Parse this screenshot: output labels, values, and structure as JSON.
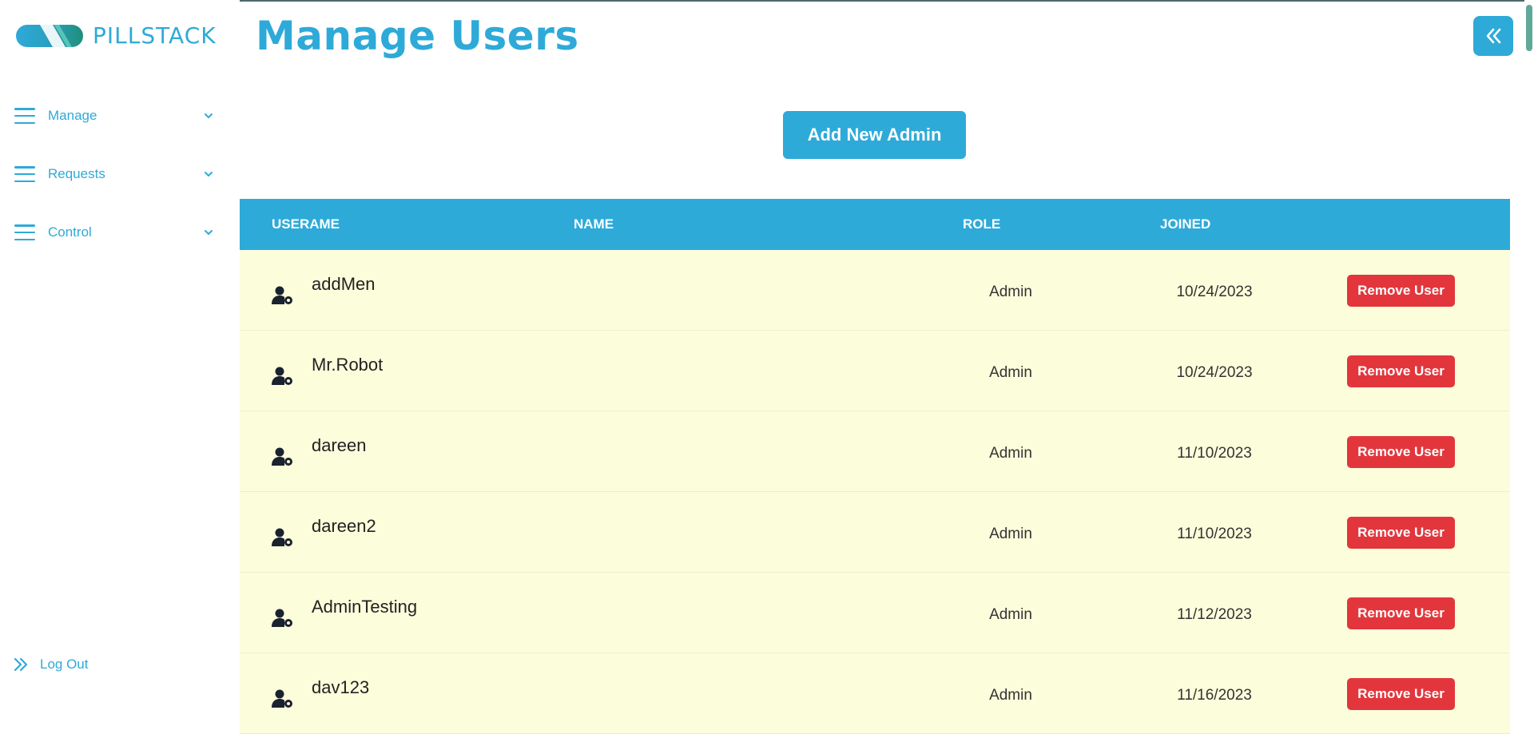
{
  "brand": {
    "name": "PILLSTACK"
  },
  "sidebar": {
    "items": [
      {
        "label": "Manage"
      },
      {
        "label": "Requests"
      },
      {
        "label": "Control"
      }
    ],
    "logout_label": "Log Out"
  },
  "header": {
    "title": "Manage Users"
  },
  "actions": {
    "add_label": "Add New Admin"
  },
  "table": {
    "columns": [
      "USERAME",
      "NAME",
      "ROLE",
      "JOINED"
    ],
    "rows": [
      {
        "username": "addMen",
        "name": "",
        "role": "Admin",
        "joined": "10/24/2023",
        "action": "Remove User"
      },
      {
        "username": "Mr.Robot",
        "name": "",
        "role": "Admin",
        "joined": "10/24/2023",
        "action": "Remove User"
      },
      {
        "username": "dareen",
        "name": "",
        "role": "Admin",
        "joined": "11/10/2023",
        "action": "Remove User"
      },
      {
        "username": "dareen2",
        "name": "",
        "role": "Admin",
        "joined": "11/10/2023",
        "action": "Remove User"
      },
      {
        "username": "AdminTesting",
        "name": "",
        "role": "Admin",
        "joined": "11/12/2023",
        "action": "Remove User"
      },
      {
        "username": "dav123",
        "name": "",
        "role": "Admin",
        "joined": "11/16/2023",
        "action": "Remove User"
      }
    ]
  },
  "colors": {
    "accent": "#2eaad8",
    "danger": "#e2363c",
    "row_bg": "#fcfddb"
  },
  "icons": {
    "nav": "hamburger-icon",
    "nav_expand": "chevron-down-icon",
    "logout": "double-chevron-right-icon",
    "collapse": "double-chevron-left-icon",
    "user": "user-gear-icon"
  }
}
